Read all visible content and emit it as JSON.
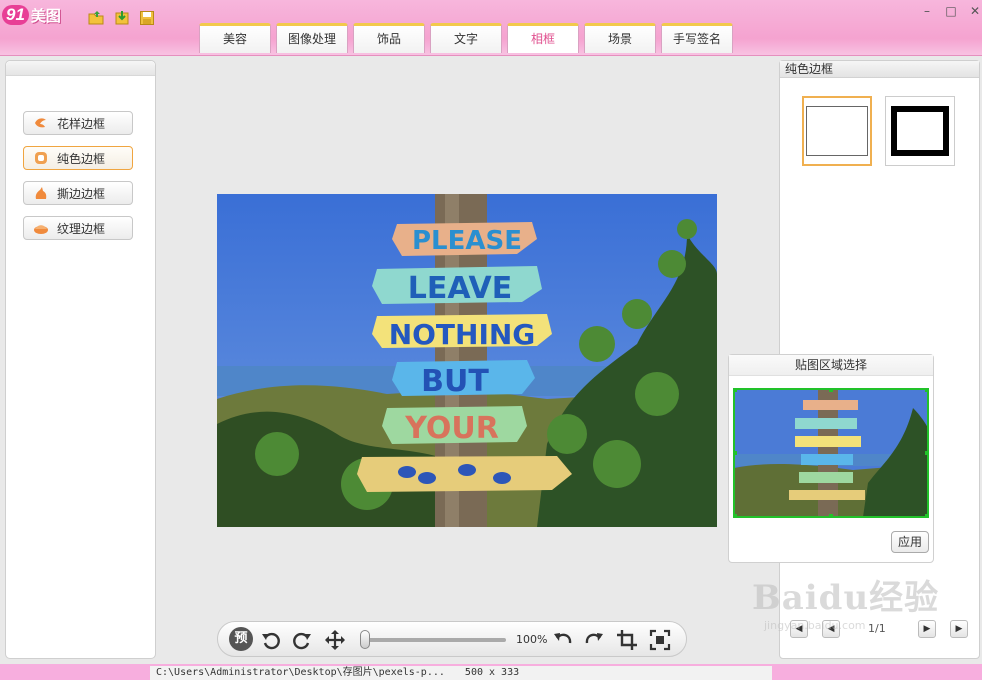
{
  "app": {
    "logo_num": "91",
    "logo_text": "美图"
  },
  "toolbar": {
    "icons": [
      "open-folder-icon",
      "import-icon",
      "save-icon"
    ]
  },
  "window_controls": {
    "minimize": "–",
    "maximize": "□",
    "close": "✕"
  },
  "tabs": [
    {
      "label": "美容",
      "active": false
    },
    {
      "label": "图像处理",
      "active": false
    },
    {
      "label": "饰品",
      "active": false
    },
    {
      "label": "文字",
      "active": false
    },
    {
      "label": "相框",
      "active": true
    },
    {
      "label": "场景",
      "active": false
    },
    {
      "label": "手写签名",
      "active": false
    }
  ],
  "left_menu": [
    {
      "label": "花样边框",
      "icon": "flower-icon",
      "active": false
    },
    {
      "label": "纯色边框",
      "icon": "solid-frame-icon",
      "active": true
    },
    {
      "label": "撕边边框",
      "icon": "torn-edge-icon",
      "active": false
    },
    {
      "label": "纹理边框",
      "icon": "texture-icon",
      "active": false
    }
  ],
  "photo": {
    "signs": [
      "PLEASE",
      "LEAVE",
      "NOTHING",
      "BUT",
      "YOUR"
    ]
  },
  "right_panel": {
    "title": "纯色边框",
    "frames": [
      "thin-white-frame",
      "thick-black-frame"
    ]
  },
  "sticker": {
    "title": "贴图区域选择",
    "apply_label": "应用"
  },
  "pager": {
    "page": "1/1"
  },
  "bottom_toolbar": {
    "preview_label": "预",
    "zoom": "100%"
  },
  "status": {
    "path": "C:\\Users\\Administrator\\Desktop\\存图片\\pexels-p...",
    "dimensions": "500 x 333"
  },
  "watermark": {
    "text": "Baidu经验",
    "sub": "jingyan.baidu.com"
  },
  "colors": {
    "pink": "#f5a3d0",
    "accent_orange": "#f0a540",
    "selection_green": "#22c22a"
  }
}
